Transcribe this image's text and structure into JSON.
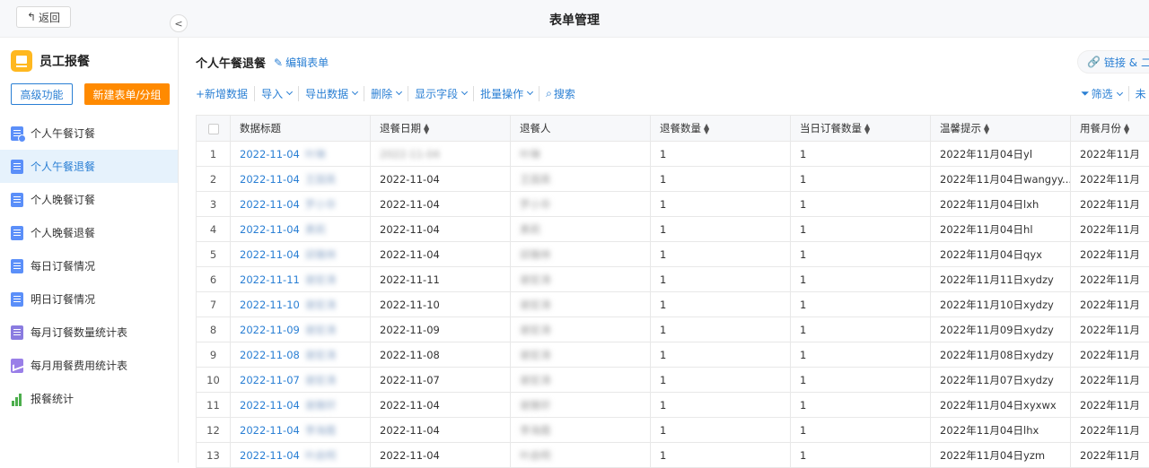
{
  "topbar": {
    "back_label": "返回",
    "title": "表单管理"
  },
  "app": {
    "name": "员工报餐",
    "advanced_label": "高级功能",
    "new_label": "新建表单/分组"
  },
  "nav": [
    {
      "label": "个人午餐订餐",
      "icon": "doc-icon"
    },
    {
      "label": "个人午餐退餐",
      "icon": "doc-icon"
    },
    {
      "label": "个人晚餐订餐",
      "icon": "doc-icon"
    },
    {
      "label": "个人晚餐退餐",
      "icon": "doc-icon"
    },
    {
      "label": "每日订餐情况",
      "icon": "list-icon"
    },
    {
      "label": "明日订餐情况",
      "icon": "list-icon"
    },
    {
      "label": "每月订餐数量统计表",
      "icon": "list-icon"
    },
    {
      "label": "每月用餐费用统计表",
      "icon": "chart-icon"
    },
    {
      "label": "报餐统计",
      "icon": "bar-chart-icon"
    }
  ],
  "active_nav_index": 1,
  "main": {
    "title": "个人午餐退餐",
    "edit_label": "编辑表单",
    "share_label": "链接 & 二维"
  },
  "toolbar": {
    "add": "+新增数据",
    "import": "导入",
    "export": "导出数据",
    "delete": "删除",
    "fields": "显示字段",
    "batch": "批量操作",
    "search": "搜索",
    "filter": "筛选",
    "more": "未"
  },
  "columns": [
    "数据标题",
    "退餐日期",
    "退餐人",
    "退餐数量",
    "当日订餐数量",
    "温馨提示",
    "用餐月份"
  ],
  "rows": [
    {
      "n": "1",
      "title": "2022-11-04",
      "who": "叶琳",
      "date": "2022-11-04",
      "qty": "1",
      "day": "1",
      "tip": "2022年11月04日yl",
      "month": "2022年11月",
      "date_blur": true
    },
    {
      "n": "2",
      "title": "2022-11-04",
      "who": "王国英",
      "date": "2022-11-04",
      "qty": "1",
      "day": "1",
      "tip": "2022年11月04日wangyy...",
      "month": "2022年11月"
    },
    {
      "n": "3",
      "title": "2022-11-04",
      "who": "罗小华",
      "date": "2022-11-04",
      "qty": "1",
      "day": "1",
      "tip": "2022年11月04日lxh",
      "month": "2022年11月"
    },
    {
      "n": "4",
      "title": "2022-11-04",
      "who": "黄莉",
      "date": "2022-11-04",
      "qty": "1",
      "day": "1",
      "tip": "2022年11月04日hl",
      "month": "2022年11月"
    },
    {
      "n": "5",
      "title": "2022-11-04",
      "who": "邱雅林",
      "date": "2022-11-04",
      "qty": "1",
      "day": "1",
      "tip": "2022年11月04日qyx",
      "month": "2022年11月"
    },
    {
      "n": "6",
      "title": "2022-11-11",
      "who": "谢宏涛",
      "date": "2022-11-11",
      "qty": "1",
      "day": "1",
      "tip": "2022年11月11日xydzy",
      "month": "2022年11月"
    },
    {
      "n": "7",
      "title": "2022-11-10",
      "who": "谢宏涛",
      "date": "2022-11-10",
      "qty": "1",
      "day": "1",
      "tip": "2022年11月10日xydzy",
      "month": "2022年11月"
    },
    {
      "n": "8",
      "title": "2022-11-09",
      "who": "谢宏涛",
      "date": "2022-11-09",
      "qty": "1",
      "day": "1",
      "tip": "2022年11月09日xydzy",
      "month": "2022年11月"
    },
    {
      "n": "9",
      "title": "2022-11-08",
      "who": "谢宏涛",
      "date": "2022-11-08",
      "qty": "1",
      "day": "1",
      "tip": "2022年11月08日xydzy",
      "month": "2022年11月"
    },
    {
      "n": "10",
      "title": "2022-11-07",
      "who": "谢宏涛",
      "date": "2022-11-07",
      "qty": "1",
      "day": "1",
      "tip": "2022年11月07日xydzy",
      "month": "2022年11月"
    },
    {
      "n": "11",
      "title": "2022-11-04",
      "who": "谢雅轩",
      "date": "2022-11-04",
      "qty": "1",
      "day": "1",
      "tip": "2022年11月04日xyxwx",
      "month": "2022年11月"
    },
    {
      "n": "12",
      "title": "2022-11-04",
      "who": "李海霞",
      "date": "2022-11-04",
      "qty": "1",
      "day": "1",
      "tip": "2022年11月04日lhx",
      "month": "2022年11月"
    },
    {
      "n": "13",
      "title": "2022-11-04",
      "who": "叶启明",
      "date": "2022-11-04",
      "qty": "1",
      "day": "1",
      "tip": "2022年11月04日yzm",
      "month": "2022年11月"
    }
  ],
  "colors": {
    "accent": "#2a7fd4",
    "primary_button": "#ff8a00",
    "logo": "#ffb820",
    "active_bg": "#e6f2fc"
  }
}
